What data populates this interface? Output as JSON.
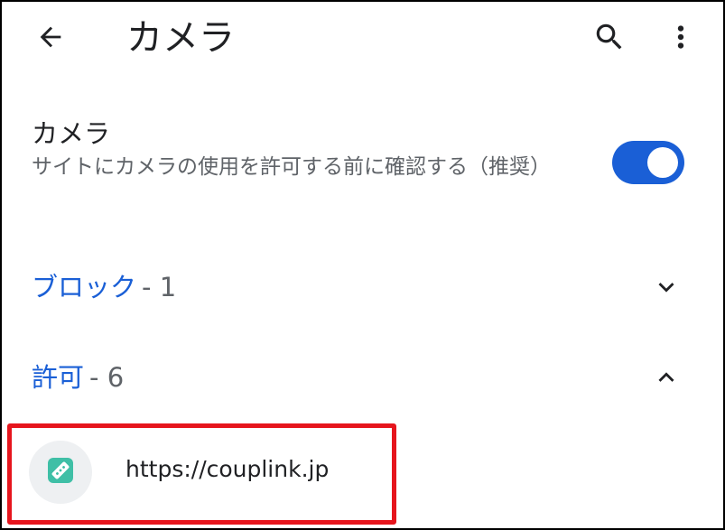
{
  "appbar": {
    "title": "カメラ",
    "back_icon": "arrow-back-icon",
    "search_icon": "search-icon",
    "more_icon": "more-vert-icon"
  },
  "camera_setting": {
    "title": "カメラ",
    "description": "サイトにカメラの使用を許可する前に確認する（推奨）",
    "toggle_on": true
  },
  "sections": {
    "blocked": {
      "label": "ブロック",
      "count": "- 1",
      "expanded": false
    },
    "allowed": {
      "label": "許可",
      "count": "- 6",
      "expanded": true
    }
  },
  "allowed_sites": [
    {
      "url": "https://couplink.jp",
      "favicon": "couplink-favicon-icon"
    }
  ],
  "colors": {
    "accent": "#1a5fd6",
    "highlight": "#e6151d",
    "favicon": "#3fbfa6"
  }
}
